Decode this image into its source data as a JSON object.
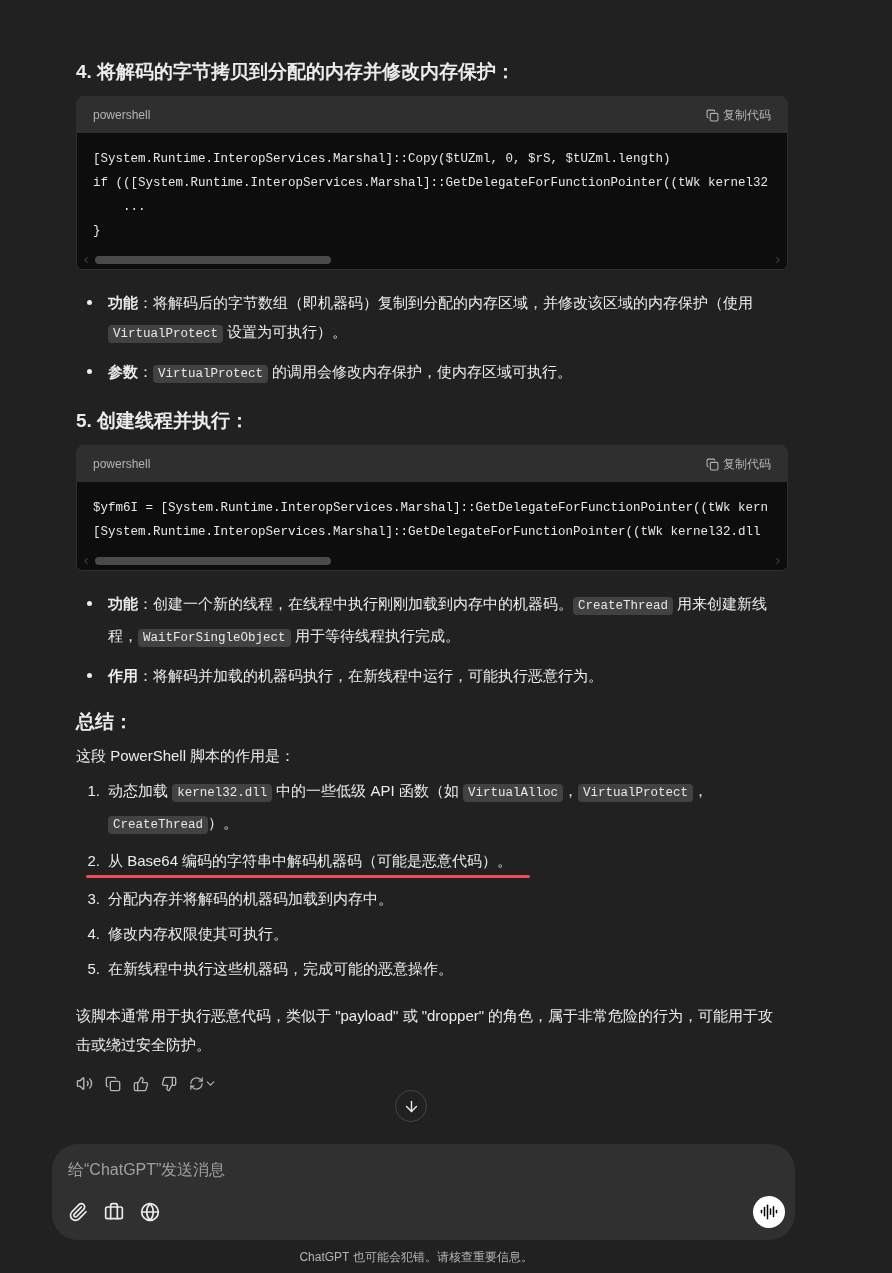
{
  "sections": [
    {
      "heading": "4. 将解码的字节拷贝到分配的内存并修改内存保护：",
      "code": {
        "language": "powershell",
        "copy_label": "复制代码",
        "lines": [
          "[System.Runtime.InteropServices.Marshal]::Copy($tUZml, 0, $rS, $tUZml.length)",
          "if (([System.Runtime.InteropServices.Marshal]::GetDelegateForFunctionPointer((tWk kernel32",
          "    ...",
          "}"
        ]
      },
      "bullets": [
        {
          "segments": [
            {
              "kind": "text",
              "text": "**功能**：将解码后的字节数组（即机器码）复制到分配的内存区域，并修改该区域的内存保护（使用 "
            },
            {
              "kind": "code",
              "text": "VirtualProtect"
            },
            {
              "kind": "text",
              "text": " 设置为可执行）。"
            }
          ]
        },
        {
          "segments": [
            {
              "kind": "text",
              "text": "**参数**："
            },
            {
              "kind": "code",
              "text": "VirtualProtect"
            },
            {
              "kind": "text",
              "text": " 的调用会修改内存保护，使内存区域可执行。"
            }
          ]
        }
      ]
    },
    {
      "heading": "5. 创建线程并执行：",
      "code": {
        "language": "powershell",
        "copy_label": "复制代码",
        "lines": [
          "$yfm6I = [System.Runtime.InteropServices.Marshal]::GetDelegateForFunctionPointer((tWk kern",
          "[System.Runtime.InteropServices.Marshal]::GetDelegateForFunctionPointer((tWk kernel32.dll"
        ]
      },
      "bullets": [
        {
          "segments": [
            {
              "kind": "text",
              "text": "**功能**：创建一个新的线程，在线程中执行刚刚加载到内存中的机器码。"
            },
            {
              "kind": "code",
              "text": "CreateThread"
            },
            {
              "kind": "text",
              "text": " 用来创建新线程，"
            },
            {
              "kind": "code",
              "text": "WaitForSingleObject"
            },
            {
              "kind": "text",
              "text": " 用于等待线程执行完成。"
            }
          ]
        },
        {
          "segments": [
            {
              "kind": "text",
              "text": "**作用**：将解码并加载的机器码执行，在新线程中运行，可能执行恶意行为。"
            }
          ]
        }
      ]
    }
  ],
  "summary": {
    "heading": "总结：",
    "intro": "这段 PowerShell 脚本的作用是：",
    "items": [
      {
        "number": "1.",
        "underlined": false,
        "segments": [
          {
            "kind": "text",
            "text": "动态加载 "
          },
          {
            "kind": "code",
            "text": "kernel32.dll"
          },
          {
            "kind": "text",
            "text": " 中的一些低级 API 函数（如 "
          },
          {
            "kind": "code",
            "text": "VirtualAlloc"
          },
          {
            "kind": "text",
            "text": "，"
          },
          {
            "kind": "code",
            "text": "VirtualProtect"
          },
          {
            "kind": "text",
            "text": "，"
          },
          {
            "kind": "code",
            "text": "CreateThread"
          },
          {
            "kind": "text",
            "text": "）。"
          }
        ]
      },
      {
        "number": "2.",
        "underlined": true,
        "segments": [
          {
            "kind": "text",
            "text": "从 Base64 编码的字符串中解码机器码（可能是恶意代码）。"
          }
        ]
      },
      {
        "number": "3.",
        "underlined": false,
        "segments": [
          {
            "kind": "text",
            "text": "分配内存并将解码的机器码加载到内存中。"
          }
        ]
      },
      {
        "number": "4.",
        "underlined": false,
        "segments": [
          {
            "kind": "text",
            "text": "修改内存权限使其可执行。"
          }
        ]
      },
      {
        "number": "5.",
        "underlined": false,
        "segments": [
          {
            "kind": "text",
            "text": "在新线程中执行这些机器码，完成可能的恶意操作。"
          }
        ]
      }
    ],
    "conclusion": "该脚本通常用于执行恶意代码，类似于 \"payload\" 或 \"dropper\" 的角色，属于非常危险的行为，可能用于攻击或绕过安全防护。"
  },
  "composer": {
    "placeholder": "给“ChatGPT”发送消息"
  },
  "footer": "ChatGPT 也可能会犯错。请核查重要信息。"
}
